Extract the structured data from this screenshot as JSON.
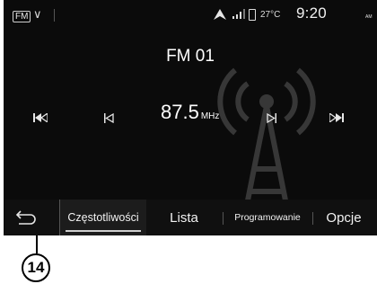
{
  "status_bar": {
    "source_badge": "FM",
    "temperature": "27°C",
    "time": "9:20",
    "ampm": "AM"
  },
  "radio": {
    "station_name": "FM 01",
    "frequency": "87.5",
    "frequency_unit": "MHz"
  },
  "tabs": [
    {
      "label": "Częstotliwości",
      "selected": true
    },
    {
      "label": "Lista",
      "selected": false
    },
    {
      "label": "Programowanie",
      "selected": false
    },
    {
      "label": "Opcje",
      "selected": false
    }
  ],
  "callout": {
    "number": "14"
  },
  "colors": {
    "screen_bg": "#0b0b0b",
    "text": "#ffffff",
    "accent": "#cfcfcf"
  },
  "icons": [
    "source-icon",
    "chevron-down-icon",
    "navigation-arrow-icon",
    "signal-bars-icon",
    "phone-icon",
    "skip-previous-icon",
    "step-back-icon",
    "step-forward-icon",
    "skip-next-icon",
    "back-arrow-icon",
    "antenna-icon"
  ]
}
